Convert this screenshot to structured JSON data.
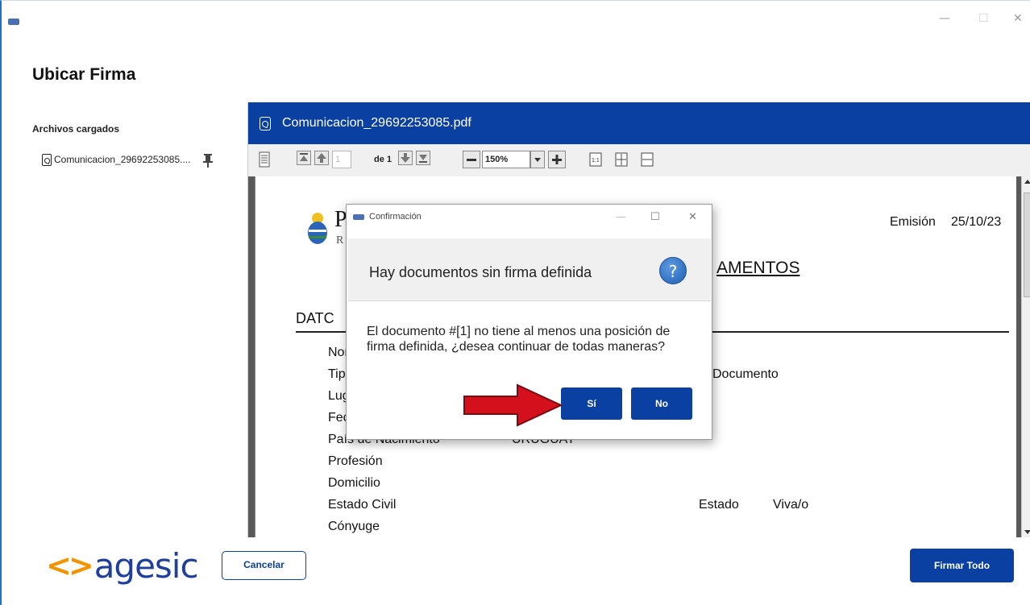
{
  "window": {
    "controls": {
      "minimize": "—",
      "maximize": "☐",
      "close": "✕"
    }
  },
  "page": {
    "title": "Ubicar Firma",
    "files_label": "Archivos cargados",
    "files": [
      {
        "name": "Comunicacion_29692253085....",
        "icon": "pdf-icon",
        "pin_icon": "pin-icon"
      }
    ]
  },
  "viewer": {
    "filename": "Comunicacion_29692253085.pdf",
    "toolbar": {
      "page_input": "1",
      "page_of": "de 1",
      "zoom": "150%",
      "zoom_options_selected": "150%",
      "icons": [
        "document-properties-icon",
        "first-page-icon",
        "previous-page-icon",
        "next-page-icon",
        "last-page-icon",
        "zoom-out-icon",
        "zoom-in-icon",
        "actual-size-icon",
        "fit-page-icon",
        "fit-width-icon"
      ]
    },
    "document": {
      "emision_label": "Emisión",
      "emision_date": "25/10/23",
      "heading_fragment": "AMENTOS",
      "section_fragment": "DATC",
      "letter_p": "P",
      "letter_r": "R",
      "rows": [
        {
          "label": "Nor",
          "value": "",
          "extra_label": "",
          "extra_value": ""
        },
        {
          "label": "Tip",
          "value": "",
          "extra_label": "Documento",
          "extra_value": ""
        },
        {
          "label": "Lug",
          "value": "",
          "extra_label": "",
          "extra_value": ""
        },
        {
          "label": "Fec",
          "value": "",
          "extra_label": "",
          "extra_value": ""
        },
        {
          "label": "País de Nacimiento",
          "value": "URUGUAY",
          "extra_label": "",
          "extra_value": ""
        },
        {
          "label": "Profesión",
          "value": "",
          "extra_label": "",
          "extra_value": ""
        },
        {
          "label": "Domicilio",
          "value": "",
          "extra_label": "",
          "extra_value": ""
        },
        {
          "label": "Estado Civil",
          "value": "",
          "extra_label": "Estado",
          "extra_value": "Viva/o"
        },
        {
          "label": "Cónyuge",
          "value": "",
          "extra_label": "",
          "extra_value": ""
        }
      ]
    }
  },
  "dialog": {
    "title": "Confirmación",
    "heading": "Hay documentos sin firma definida",
    "message": "El documento #[1] no tiene al menos una posición de firma definida, ¿desea continuar de todas maneras?",
    "yes_label": "Sí",
    "no_label": "No",
    "help_glyph": "?",
    "controls": {
      "minimize": "—",
      "maximize": "☐",
      "close": "✕"
    }
  },
  "footer": {
    "logo_glyph": "<>",
    "logo_text": "agesic",
    "cancel_label": "Cancelar",
    "sign_all_label": "Firmar Todo"
  },
  "colors": {
    "brand_blue": "#0b40a3",
    "logo_orange": "#f29400",
    "logo_blue": "#1f3f9d",
    "annotation_red": "#d4101c"
  }
}
